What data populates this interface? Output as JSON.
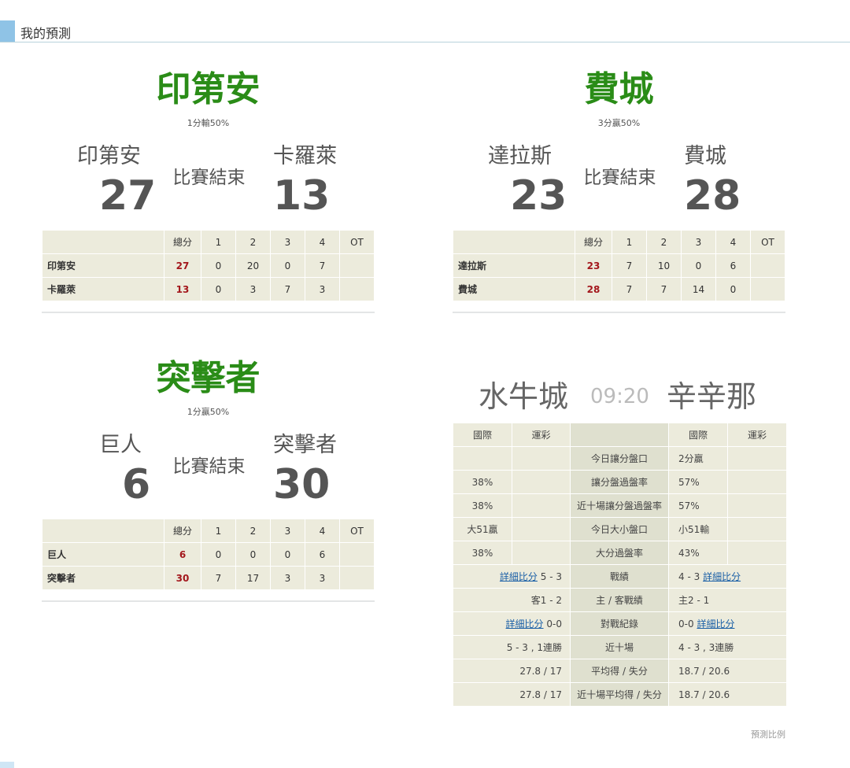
{
  "header": {
    "title": "我的預測"
  },
  "games": [
    {
      "winner": "印第安",
      "note": "1分輸50%",
      "away": "印第安",
      "away_score": "27",
      "home": "卡羅萊",
      "home_score": "13",
      "status": "比賽結束",
      "columns": [
        "",
        "總分",
        "1",
        "2",
        "3",
        "4",
        "OT"
      ],
      "rows": [
        [
          "印第安",
          "27",
          "0",
          "20",
          "0",
          "7",
          ""
        ],
        [
          "卡羅萊",
          "13",
          "0",
          "3",
          "7",
          "3",
          ""
        ]
      ]
    },
    {
      "winner": "費城",
      "note": "3分贏50%",
      "away": "達拉斯",
      "away_score": "23",
      "home": "費城",
      "home_score": "28",
      "status": "比賽結束",
      "columns": [
        "",
        "總分",
        "1",
        "2",
        "3",
        "4",
        "OT"
      ],
      "rows": [
        [
          "達拉斯",
          "23",
          "7",
          "10",
          "0",
          "6",
          ""
        ],
        [
          "費城",
          "28",
          "7",
          "7",
          "14",
          "0",
          ""
        ]
      ]
    },
    {
      "winner": "突擊者",
      "note": "1分贏50%",
      "away": "巨人",
      "away_score": "6",
      "home": "突擊者",
      "home_score": "30",
      "status": "比賽結束",
      "columns": [
        "",
        "總分",
        "1",
        "2",
        "3",
        "4",
        "OT"
      ],
      "rows": [
        [
          "巨人",
          "6",
          "0",
          "0",
          "0",
          "6",
          ""
        ],
        [
          "突擊者",
          "30",
          "7",
          "17",
          "3",
          "3",
          ""
        ]
      ]
    }
  ],
  "matchup": {
    "home": "水牛城",
    "time": "09:20",
    "away": "辛辛那",
    "head_intl": "國際",
    "head_lottery": "運彩",
    "rows": {
      "handicap": {
        "label": "今日讓分盤口",
        "right": "2分贏"
      },
      "cover_rate": {
        "label": "讓分盤過盤率",
        "left": "38%",
        "right": "57%"
      },
      "last10_cover": {
        "label": "近十場讓分盤過盤率",
        "left": "38%",
        "right": "57%"
      },
      "total_line": {
        "label": "今日大小盤口",
        "left": "大51贏",
        "right": "小51輸"
      },
      "over_rate": {
        "label": "大分過盤率",
        "left": "38%",
        "right": "43%"
      },
      "record": {
        "label": "戰績",
        "left_link": "詳細比分",
        "left_val": "5 - 3",
        "right_val": "4 - 3",
        "right_link": "詳細比分"
      },
      "home_away": {
        "label": "主 / 客戰績",
        "left": "客1 - 2",
        "right": "主2 - 1"
      },
      "h2h": {
        "label": "對戰紀錄",
        "left_link": "詳細比分",
        "left_val": "0-0",
        "right_val": "0-0",
        "right_link": "詳細比分"
      },
      "last10": {
        "label": "近十場",
        "left": "5 - 3 , 1連勝",
        "right": "4 - 3 , 3連勝"
      },
      "avg": {
        "label": "平均得 / 失分",
        "left": "27.8 / 17",
        "right": "18.7 / 20.6"
      },
      "last10_avg": {
        "label": "近十場平均得 / 失分",
        "left": "27.8 / 17",
        "right": "18.7 / 20.6"
      }
    },
    "footnote": "預測比例"
  }
}
